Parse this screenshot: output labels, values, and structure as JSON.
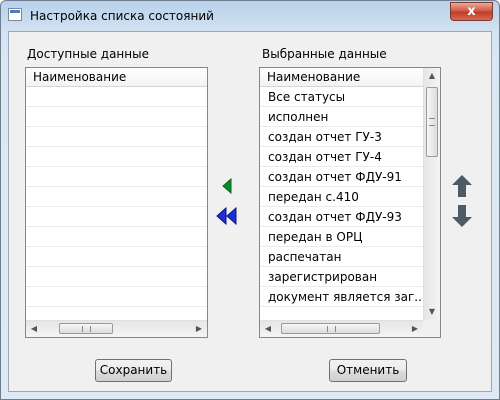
{
  "window": {
    "title": "Настройка списка состояний",
    "close_glyph": "x"
  },
  "available": {
    "label": "Доступные данные",
    "column_header": "Наименование",
    "items": []
  },
  "selected": {
    "label": "Выбранные данные",
    "column_header": "Наименование",
    "items": [
      "Все статусы",
      "исполнен",
      "создан отчет ГУ-3",
      "создан отчет ГУ-4",
      "создан отчет ФДУ-91",
      "передан с.410",
      "создан отчет ФДУ-93",
      "передан в ОРЦ",
      "распечатан",
      "зарегистрирован",
      "документ является заг..."
    ]
  },
  "transfer": {
    "move_left_icon": "green-left-triangle",
    "move_all_left_icon": "blue-double-left-triangle"
  },
  "ordering": {
    "move_up_icon": "arrow-up",
    "move_down_icon": "arrow-down"
  },
  "buttons": {
    "save": "Сохранить",
    "cancel": "Отменить"
  },
  "colors": {
    "move_left": "#0b8a1e",
    "move_all_left": "#1c2fd6",
    "order_arrows": "#4e5a64",
    "close_button": "#c8432b"
  }
}
